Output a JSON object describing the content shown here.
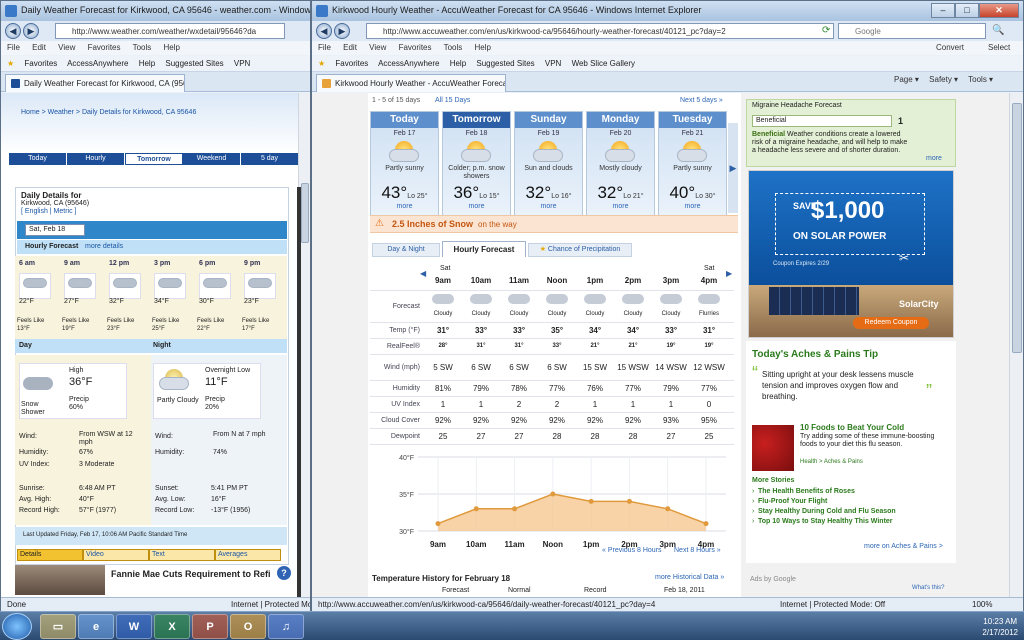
{
  "left_window": {
    "title": "Daily Weather Forecast for Kirkwood, CA 95646 - weather.com - Windows Internet Explorer",
    "address": "http://www.weather.com/weather/wxdetail/95646?da",
    "menu": [
      "File",
      "Edit",
      "View",
      "Favorites",
      "Tools",
      "Help"
    ],
    "favorites": [
      "Favorites",
      "AccessAnywhere",
      "Help",
      "Suggested Sites",
      "VPN"
    ],
    "tab_title": "Daily Weather Forecast for Kirkwood, CA (95646) ...",
    "status": "Done",
    "status_zone": "Internet | Protected Mod",
    "page": {
      "breadcrumb": "Home > Weather > Daily Details for Kirkwood, CA 95646",
      "tabs": [
        "Today",
        "Hourly",
        "Tomorrow",
        "Weekend",
        "5 day"
      ],
      "heading": "Daily Details for",
      "location": "Kirkwood, CA (95646)",
      "units": "[ English | Metric ]",
      "date_select": "Sat, Feb 18",
      "hourly_label": "Hourly Forecast",
      "more_details": "more details",
      "hours": [
        "6 am",
        "9 am",
        "12 pm",
        "3 pm",
        "6 pm",
        "9 pm"
      ],
      "temps": [
        "22°F",
        "27°F",
        "32°F",
        "34°F",
        "30°F",
        "23°F"
      ],
      "feels_label": "Feels Like",
      "feels": [
        "13°F",
        "19°F",
        "23°F",
        "25°F",
        "22°F",
        "17°F"
      ],
      "day_label": "Day",
      "night_label": "Night",
      "day": {
        "cond": "Snow Shower",
        "high_label": "High",
        "high": "36°F",
        "precip_label": "Precip",
        "precip": "60%",
        "wind_label": "Wind:",
        "wind": "From WSW at 12 mph",
        "hum_label": "Humidity:",
        "hum": "67%",
        "uv_label": "UV Index:",
        "uv": "3 Moderate",
        "sunrise_label": "Sunrise:",
        "sunrise": "6:48 AM PT",
        "avg_label": "Avg. High:",
        "avg": "40°F",
        "rec_label": "Record High:",
        "rec": "57°F (1977)"
      },
      "night": {
        "cond": "Partly Cloudy",
        "low_label": "Overnight Low",
        "low": "11°F",
        "precip_label": "Precip",
        "precip": "20%",
        "wind_label": "Wind:",
        "wind": "From N at 7 mph",
        "hum_label": "Humidity:",
        "hum": "74%",
        "sunset_label": "Sunset:",
        "sunset": "5:41 PM PT",
        "avg_label": "Avg. Low:",
        "avg": "16°F",
        "rec_label": "Record Low:",
        "rec": "-13°F (1956)"
      },
      "updated": "Last Updated Friday, Feb 17, 10:06 AM Pacific Standard Time",
      "bottom_tabs": [
        "Details",
        "Video",
        "Text",
        "Averages"
      ],
      "ad_text": "Fannie Mae Cuts Requirement to Refi"
    }
  },
  "right_window": {
    "title": "Kirkwood Hourly Weather - AccuWeather Forecast for CA 95646 - Windows Internet Explorer",
    "address": "http://www.accuweather.com/en/us/kirkwood-ca/95646/hourly-weather-forecast/40121_pc?day=2",
    "search": "Google",
    "menu": [
      "File",
      "Edit",
      "View",
      "Favorites",
      "Tools",
      "Help"
    ],
    "favorites": [
      "Favorites",
      "AccessAnywhere",
      "Help",
      "Suggested Sites",
      "VPN",
      "Web Slice Gallery"
    ],
    "tab_title": "Kirkwood Hourly Weather - AccuWeather Foreca...",
    "cmd": [
      "Page ▾",
      "Safety ▾",
      "Tools ▾"
    ],
    "convert": "Convert",
    "select": "Select",
    "status_url": "http://www.accuweather.com/en/us/kirkwood-ca/95646/daily-weather-forecast/40121_pc?day=4",
    "status_zone": "Internet | Protected Mode: Off",
    "zoom": "100%",
    "page": {
      "range": "1 - 5 of 15 days",
      "all_days": "All 15 Days",
      "next_days": "Next 5 days »",
      "days": [
        {
          "name": "Today",
          "date": "Feb 17",
          "phrase": "Partly sunny",
          "hi": "43°",
          "lo": "Lo 25°"
        },
        {
          "name": "Tomorrow",
          "date": "Feb 18",
          "phrase": "Colder; p.m. snow showers",
          "hi": "36°",
          "lo": "Lo 15°"
        },
        {
          "name": "Sunday",
          "date": "Feb 19",
          "phrase": "Sun and clouds",
          "hi": "32°",
          "lo": "Lo 16°"
        },
        {
          "name": "Monday",
          "date": "Feb 20",
          "phrase": "Mostly cloudy",
          "hi": "32°",
          "lo": "Lo 21°"
        },
        {
          "name": "Tuesday",
          "date": "Feb 21",
          "phrase": "Partly sunny",
          "hi": "40°",
          "lo": "Lo 30°"
        }
      ],
      "more": "more",
      "snow_alert_amt": "2.5 Inches of Snow",
      "snow_alert_rest": "on the way",
      "subtabs": [
        "Day & Night",
        "Hourly Forecast",
        "Chance of Precipitation"
      ],
      "sat": "Sat",
      "hours": [
        "9am",
        "10am",
        "11am",
        "Noon",
        "1pm",
        "2pm",
        "3pm",
        "4pm"
      ],
      "forecast_label": "Forecast",
      "conds": [
        "Cloudy",
        "Cloudy",
        "Cloudy",
        "Cloudy",
        "Cloudy",
        "Cloudy",
        "Cloudy",
        "Flurries"
      ],
      "temp_label": "Temp (°F)",
      "temps": [
        "31°",
        "33°",
        "33°",
        "35°",
        "34°",
        "34°",
        "33°",
        "31°"
      ],
      "realfeel_label": "RealFeel®",
      "realfeel": [
        "28°",
        "31°",
        "31°",
        "33°",
        "21°",
        "21°",
        "19°",
        "19°"
      ],
      "wind_label": "Wind (mph)",
      "wind": [
        "5 SW",
        "6 SW",
        "6 SW",
        "6 SW",
        "15 SW",
        "15 WSW",
        "14 WSW",
        "12 WSW"
      ],
      "hum_label": "Humidity",
      "hum": [
        "81%",
        "79%",
        "78%",
        "77%",
        "76%",
        "77%",
        "79%",
        "77%"
      ],
      "uv_label": "UV Index",
      "uv": [
        "1",
        "1",
        "2",
        "2",
        "1",
        "1",
        "1",
        "0"
      ],
      "cc_label": "Cloud Cover",
      "cc": [
        "92%",
        "92%",
        "92%",
        "92%",
        "92%",
        "92%",
        "93%",
        "95%"
      ],
      "dew_label": "Dewpoint",
      "dew": [
        "25",
        "27",
        "27",
        "28",
        "28",
        "28",
        "27",
        "25"
      ],
      "prev": "« Previous 8 Hours",
      "next": "Next 8 Hours »",
      "history_title": "Temperature History for February 18",
      "history_link": "more Historical Data »",
      "history_cols": [
        "Forecast",
        "Normal",
        "Record",
        "Feb 18, 2011"
      ],
      "migraine_title": "Migraine Headache Forecast",
      "migraine_value": "Beneficial",
      "migraine_num": "1",
      "migraine_desc_b": "Beneficial",
      "migraine_desc": "Weather conditions create a lowered risk of a migraine headache, and will help to make a headache less severe and of shorter duration.",
      "aches_title": "Today's Aches & Pains Tip",
      "aches_text": "Sitting upright at your desk lessens muscle tension and improves oxygen flow and breathing.",
      "foods_title": "10 Foods to Beat Your Cold",
      "foods_text": "Try adding some of these immune-boosting foods to your diet this flu season.",
      "foods_link": "Health > Aches & Pains",
      "more_stories": "More Stories",
      "stories": [
        "The Health Benefits of Roses",
        "Flu-Proof Your Flight",
        "Stay Healthy During Cold and Flu Season",
        "Top 10 Ways to Stay Healthy This Winter"
      ],
      "more_aches": "more on Aches & Pains >",
      "ads_by": "Ads by Google",
      "whats_this": "What's this?",
      "ad_save": "SAVE",
      "ad_amount": "$1,000",
      "ad_solar": "ON SOLAR POWER",
      "ad_coupon": "Coupon Expires 2/29",
      "ad_brand": "SolarCity",
      "ad_redeem": "Redeem Coupon"
    }
  },
  "chart_data": {
    "type": "area",
    "categories": [
      "9am",
      "10am",
      "11am",
      "Noon",
      "1pm",
      "2pm",
      "3pm",
      "4pm"
    ],
    "values": [
      31,
      33,
      33,
      35,
      34,
      34,
      33,
      31
    ],
    "ylim": [
      30,
      40
    ],
    "yticks": [
      "40°F",
      "35°F",
      "30°F"
    ],
    "grid": true
  },
  "taskbar": {
    "time": "10:23 AM",
    "date": "2/17/2012"
  },
  "colors": {
    "accent": "#1d4f98",
    "accu_blue": "#2c5fa6",
    "chart_fill": "#f6c48b",
    "chart_line": "#e09a3c"
  }
}
